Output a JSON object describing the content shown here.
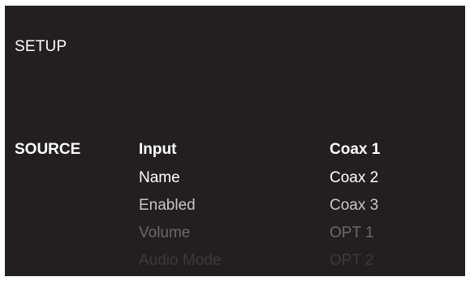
{
  "menu": {
    "title": "SETUP",
    "section": "SOURCE"
  },
  "parameters": [
    {
      "label": "Input"
    },
    {
      "label": "Name"
    },
    {
      "label": "Enabled"
    },
    {
      "label": "Volume"
    },
    {
      "label": "Audio Mode"
    }
  ],
  "values": [
    {
      "label": "Coax 1"
    },
    {
      "label": "Coax 2"
    },
    {
      "label": "Coax 3"
    },
    {
      "label": "OPT 1"
    },
    {
      "label": "OPT 2"
    }
  ],
  "selected_index": 0,
  "colors": {
    "background": "#231f20",
    "text_primary": "#ffffff"
  }
}
